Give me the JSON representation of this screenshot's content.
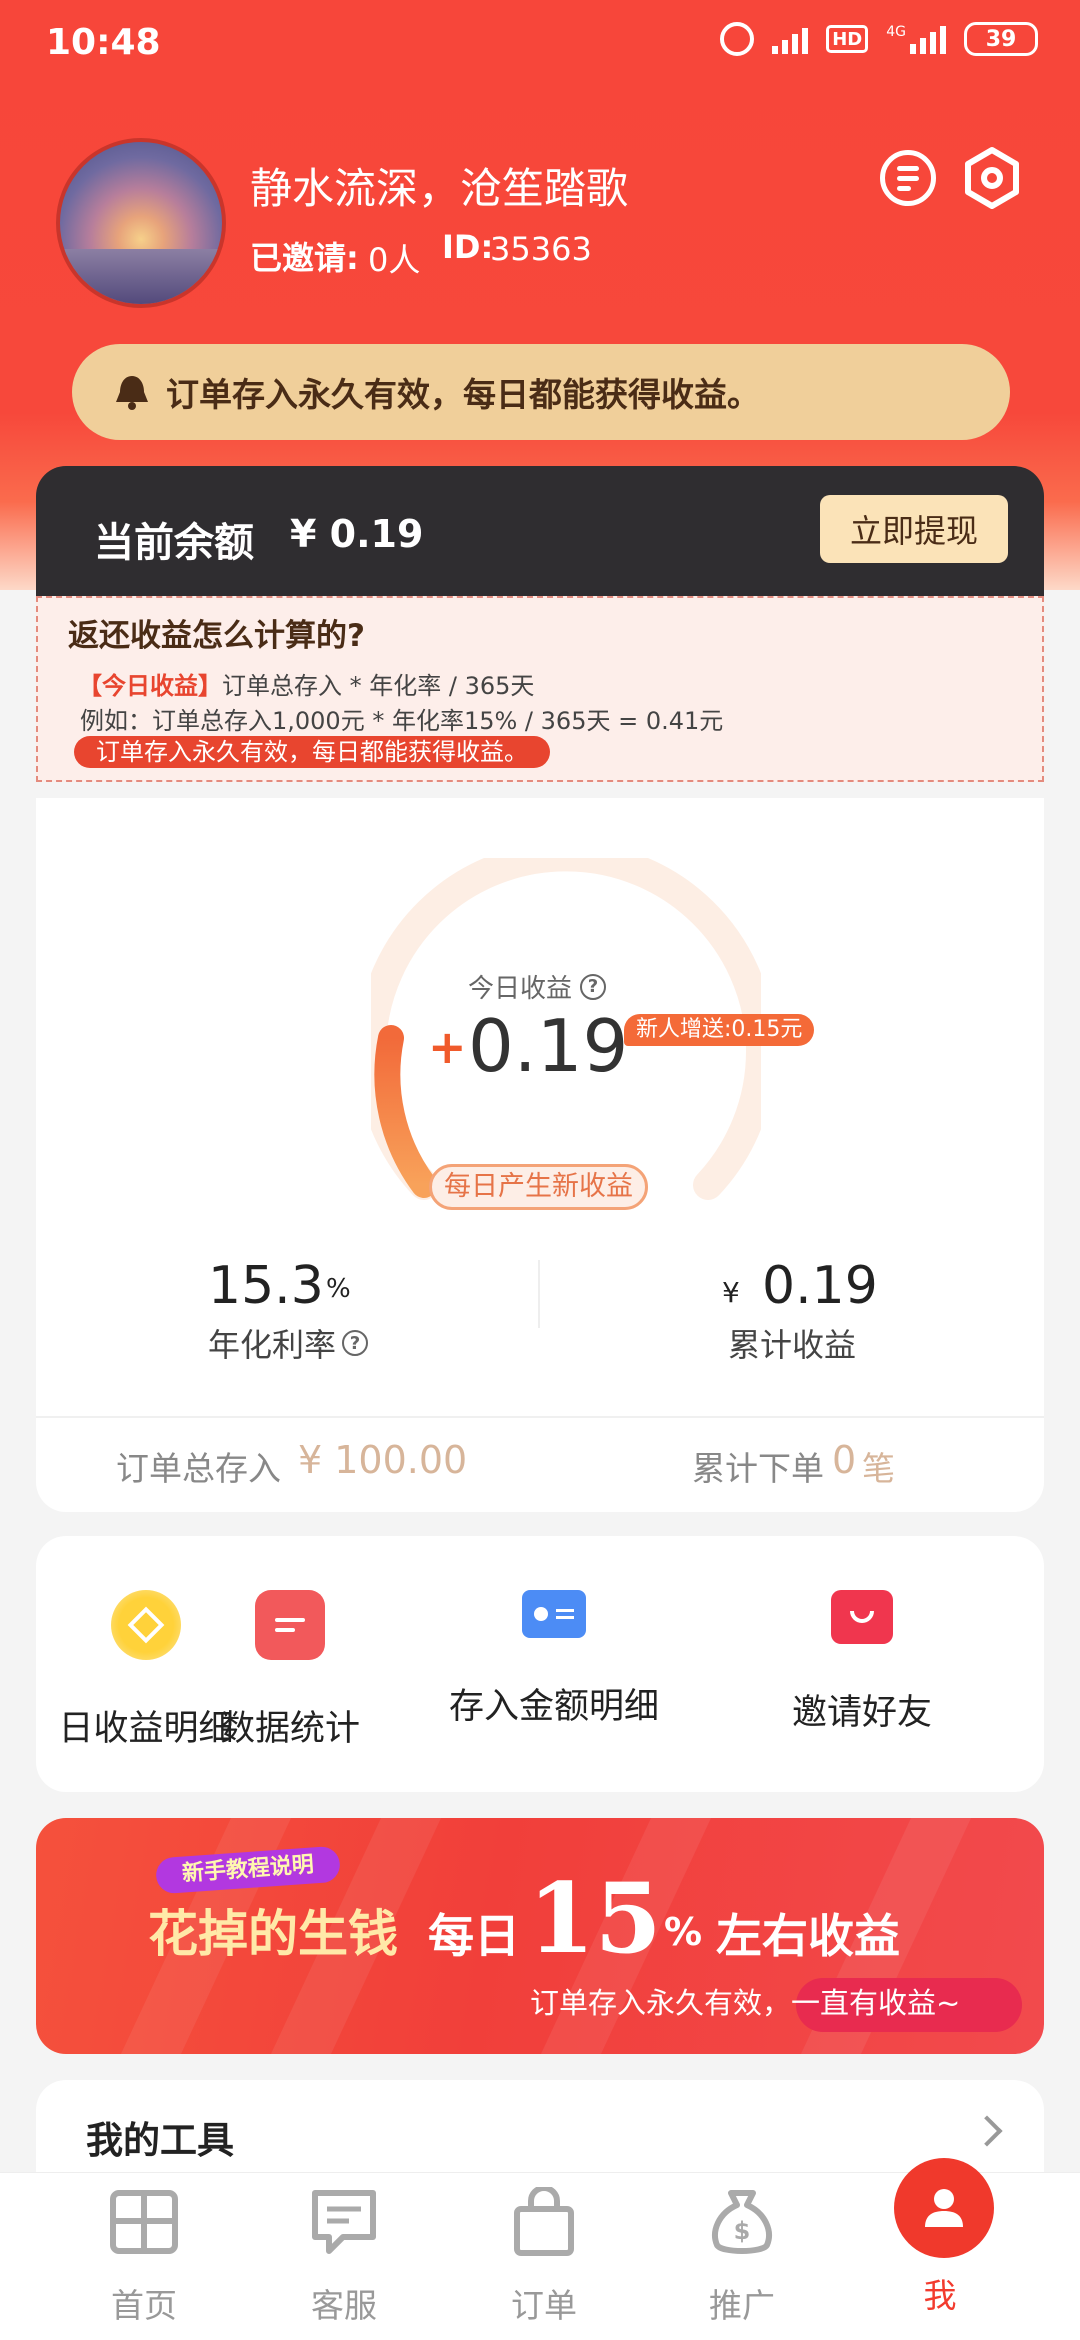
{
  "status_bar": {
    "time": "10:48",
    "network": "4G",
    "hd": "HD",
    "battery": "39",
    "icons": [
      "alarm-icon",
      "signal-icon",
      "hd-icon",
      "signal-4g-icon",
      "battery-icon"
    ]
  },
  "profile": {
    "name": "静水流深，沧笙踏歌",
    "invited_label": "已邀请:",
    "invited_value": "0人",
    "id_label": "ID:",
    "id_value": "35363",
    "icons": [
      "message-icon",
      "settings-icon"
    ]
  },
  "notice": {
    "icon": "bell-icon",
    "text": "订单存入永久有效，每日都能获得收益。"
  },
  "balance": {
    "label": "当前余额",
    "value": "¥ 0.19",
    "withdraw_label": "立即提现"
  },
  "explain": {
    "title": "返还收益怎么计算的?",
    "today_tag": "【今日收益】",
    "formula": "订单总存入 * 年化率 / 365天",
    "example": "例如：订单总存入1,000元 * 年化率15% / 365天 = 0.41元",
    "pill": "订单存入永久有效，每日都能获得收益。"
  },
  "earnings": {
    "today_label": "今日收益",
    "plus": "+",
    "today_value": "0.19",
    "bonus": "新人增送:0.15元",
    "daily_badge": "每日产生新收益",
    "rate_value": "15.3",
    "rate_unit": "%",
    "rate_label": "年化利率",
    "total_currency": "¥",
    "total_value": "0.19",
    "total_label": "累计收益",
    "deposit_label": "订单总存入",
    "deposit_value": "¥ 100.00",
    "orders_label": "累计下单",
    "orders_value": "0",
    "orders_unit": "笔",
    "help_glyph": "?"
  },
  "functions": [
    {
      "label": "日收益明细",
      "icon": "coin-icon"
    },
    {
      "label": "数据统计",
      "icon": "document-icon"
    },
    {
      "label": "存入金额明细",
      "icon": "id-card-icon"
    },
    {
      "label": "邀请好友",
      "icon": "gift-icon"
    }
  ],
  "banner": {
    "tag": "新手教程说明",
    "title": "花掉的生钱",
    "daily": "每日",
    "rate": "15",
    "percent": "%",
    "suffix": "左右收益",
    "subtitle": "订单存入永久有效，一直有收益~"
  },
  "tools": {
    "title": "我的工具"
  },
  "nav": [
    {
      "label": "首页",
      "icon": "home-grid-icon"
    },
    {
      "label": "客服",
      "icon": "chat-icon"
    },
    {
      "label": "订单",
      "icon": "bag-icon"
    },
    {
      "label": "推广",
      "icon": "money-bag-icon"
    },
    {
      "label": "我",
      "icon": "user-icon"
    }
  ],
  "colors": {
    "primary": "#f23b2e",
    "balance_card": "#2f2d30",
    "notice_bg": "#f0cf9a",
    "accent_orange": "#f46a38"
  }
}
